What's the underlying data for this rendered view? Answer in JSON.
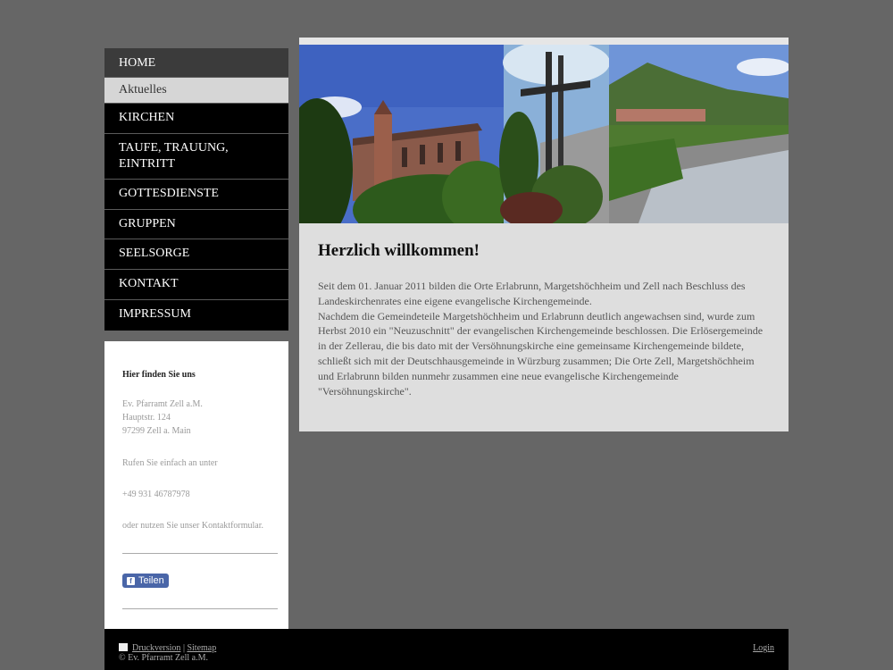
{
  "nav": {
    "items": [
      {
        "label": "HOME"
      },
      {
        "label": "Aktuelles"
      },
      {
        "label": "KIRCHEN"
      },
      {
        "label": "TAUFE, TRAUUNG, EINTRITT"
      },
      {
        "label": "GOTTESDIENSTE"
      },
      {
        "label": "GRUPPEN"
      },
      {
        "label": "SEELSORGE"
      },
      {
        "label": "KONTAKT"
      },
      {
        "label": "IMPRESSUM"
      }
    ]
  },
  "sidebar": {
    "heading": "Hier finden Sie uns",
    "address": [
      "Ev. Pfarramt Zell a.M.",
      "Hauptstr. 124",
      "97299 Zell a. Main"
    ],
    "call_text": "Rufen Sie einfach an unter",
    "phone": "+49 931 46787978",
    "contact_text": "oder nutzen Sie unser Kontaktformular.",
    "share_label": "Teilen"
  },
  "main": {
    "title": "Herzlich willkommen!",
    "paragraphs": [
      "Seit dem 01. Januar 2011 bilden die Orte Erlabrunn, Margetshöchheim und Zell nach Beschluss des Landeskirchenrates eine eigene evangelische Kirchengemeinde.",
      "Nachdem die Gemeindeteile Margetshöchheim und Erlabrunn deutlich angewachsen sind, wurde zum Herbst 2010 ein \"Neuzuschnitt\" der evangelischen Kirchengemeinde beschlossen. Die Erlösergemeinde in der Zellerau, die bis dato mit der Versöhnungskirche eine gemeinsame Kirchengemeinde bildete, schließt sich mit der Deutschhausgemeinde in Würzburg zusammen; Die Orte Zell, Margetshöchheim und Erlabrunn bilden nunmehr zusammen eine neue evangelische Kirchengemeinde \"Versöhnungskirche\"."
    ]
  },
  "footer": {
    "print_label": "Druckversion",
    "separator": "|",
    "sitemap_label": "Sitemap",
    "copyright": "© Ev. Pfarramt Zell a.M.",
    "login_label": "Login"
  },
  "colors": {
    "background": "#666666",
    "nav_active": "#3b3b3b",
    "nav_sub": "#d6d6d6",
    "content_bg": "#dedede",
    "share_button": "#4a66a8"
  },
  "icons": {
    "print": "print-icon",
    "facebook": "facebook-icon"
  }
}
